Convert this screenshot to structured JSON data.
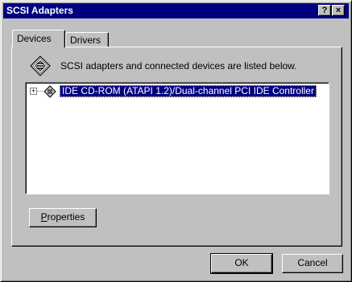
{
  "window": {
    "title": "SCSI Adapters",
    "help_label": "?",
    "close_label": "×"
  },
  "tabs": [
    {
      "label": "Devices",
      "active": true
    },
    {
      "label": "Drivers",
      "active": false
    }
  ],
  "panel": {
    "header_text": "SCSI adapters and connected devices are listed below.",
    "tree": [
      {
        "expander": "+",
        "label": "IDE CD-ROM (ATAPI 1.2)/Dual-channel PCI IDE Controller",
        "selected": true
      }
    ],
    "properties_label_prefix": "P",
    "properties_label_rest": "roperties"
  },
  "buttons": {
    "ok": "OK",
    "cancel": "Cancel"
  }
}
